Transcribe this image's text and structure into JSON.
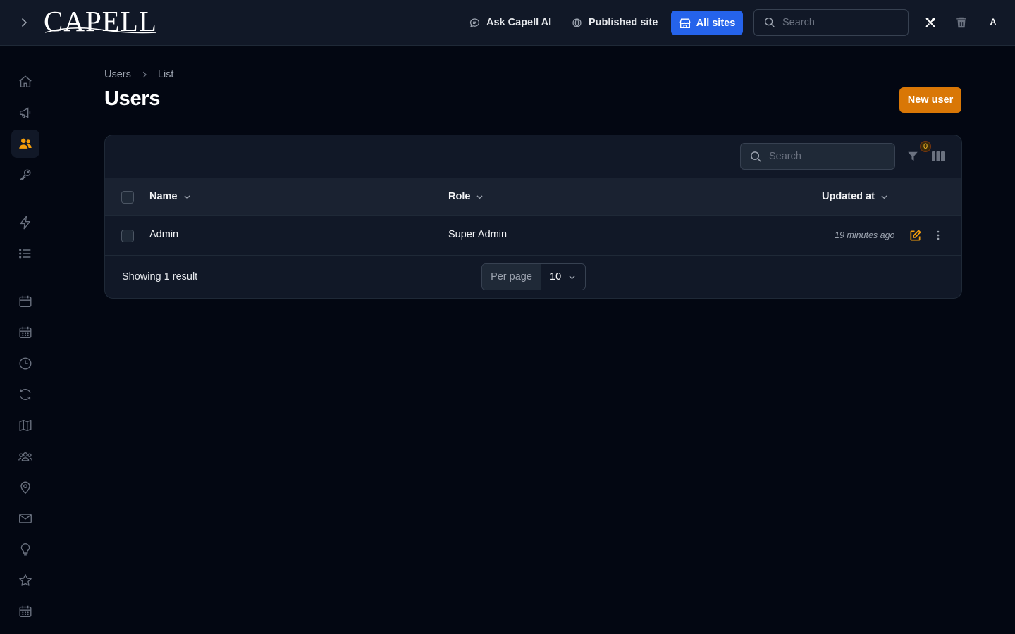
{
  "header": {
    "logo_text": "CAPELL",
    "ask_ai_label": "Ask Capell AI",
    "published_site_label": "Published site",
    "all_sites_label": "All sites",
    "search_placeholder": "Search",
    "avatar_initial": "A"
  },
  "sidebar": {
    "items": [
      {
        "icon": "home-icon"
      },
      {
        "icon": "megaphone-icon"
      },
      {
        "icon": "users-icon",
        "active": true
      },
      {
        "icon": "key-icon"
      },
      {
        "icon": "bolt-icon"
      },
      {
        "icon": "list-icon"
      },
      {
        "icon": "calendar-icon"
      },
      {
        "icon": "calendar-days-icon"
      },
      {
        "icon": "clock-icon"
      },
      {
        "icon": "refresh-icon"
      },
      {
        "icon": "map-icon"
      },
      {
        "icon": "user-group-icon"
      },
      {
        "icon": "map-pin-icon"
      },
      {
        "icon": "envelope-icon"
      },
      {
        "icon": "light-bulb-icon"
      },
      {
        "icon": "star-icon"
      },
      {
        "icon": "calendar-days-icon"
      }
    ]
  },
  "breadcrumb": {
    "items": [
      "Users",
      "List"
    ]
  },
  "page": {
    "title": "Users",
    "new_button_label": "New user"
  },
  "table": {
    "search_placeholder": "Search",
    "filter_count": "0",
    "columns": [
      "Name",
      "Role",
      "Updated at"
    ],
    "rows": [
      {
        "name": "Admin",
        "role": "Super Admin",
        "updated_at": "19 minutes ago"
      }
    ],
    "footer": {
      "result_text": "Showing 1 result",
      "per_page_label": "Per page",
      "per_page_value": "10"
    }
  },
  "colors": {
    "background": "#030712",
    "surface": "#111827",
    "accent": "#f59e0b",
    "primary_button": "#d97706",
    "all_sites_button": "#2563eb"
  }
}
